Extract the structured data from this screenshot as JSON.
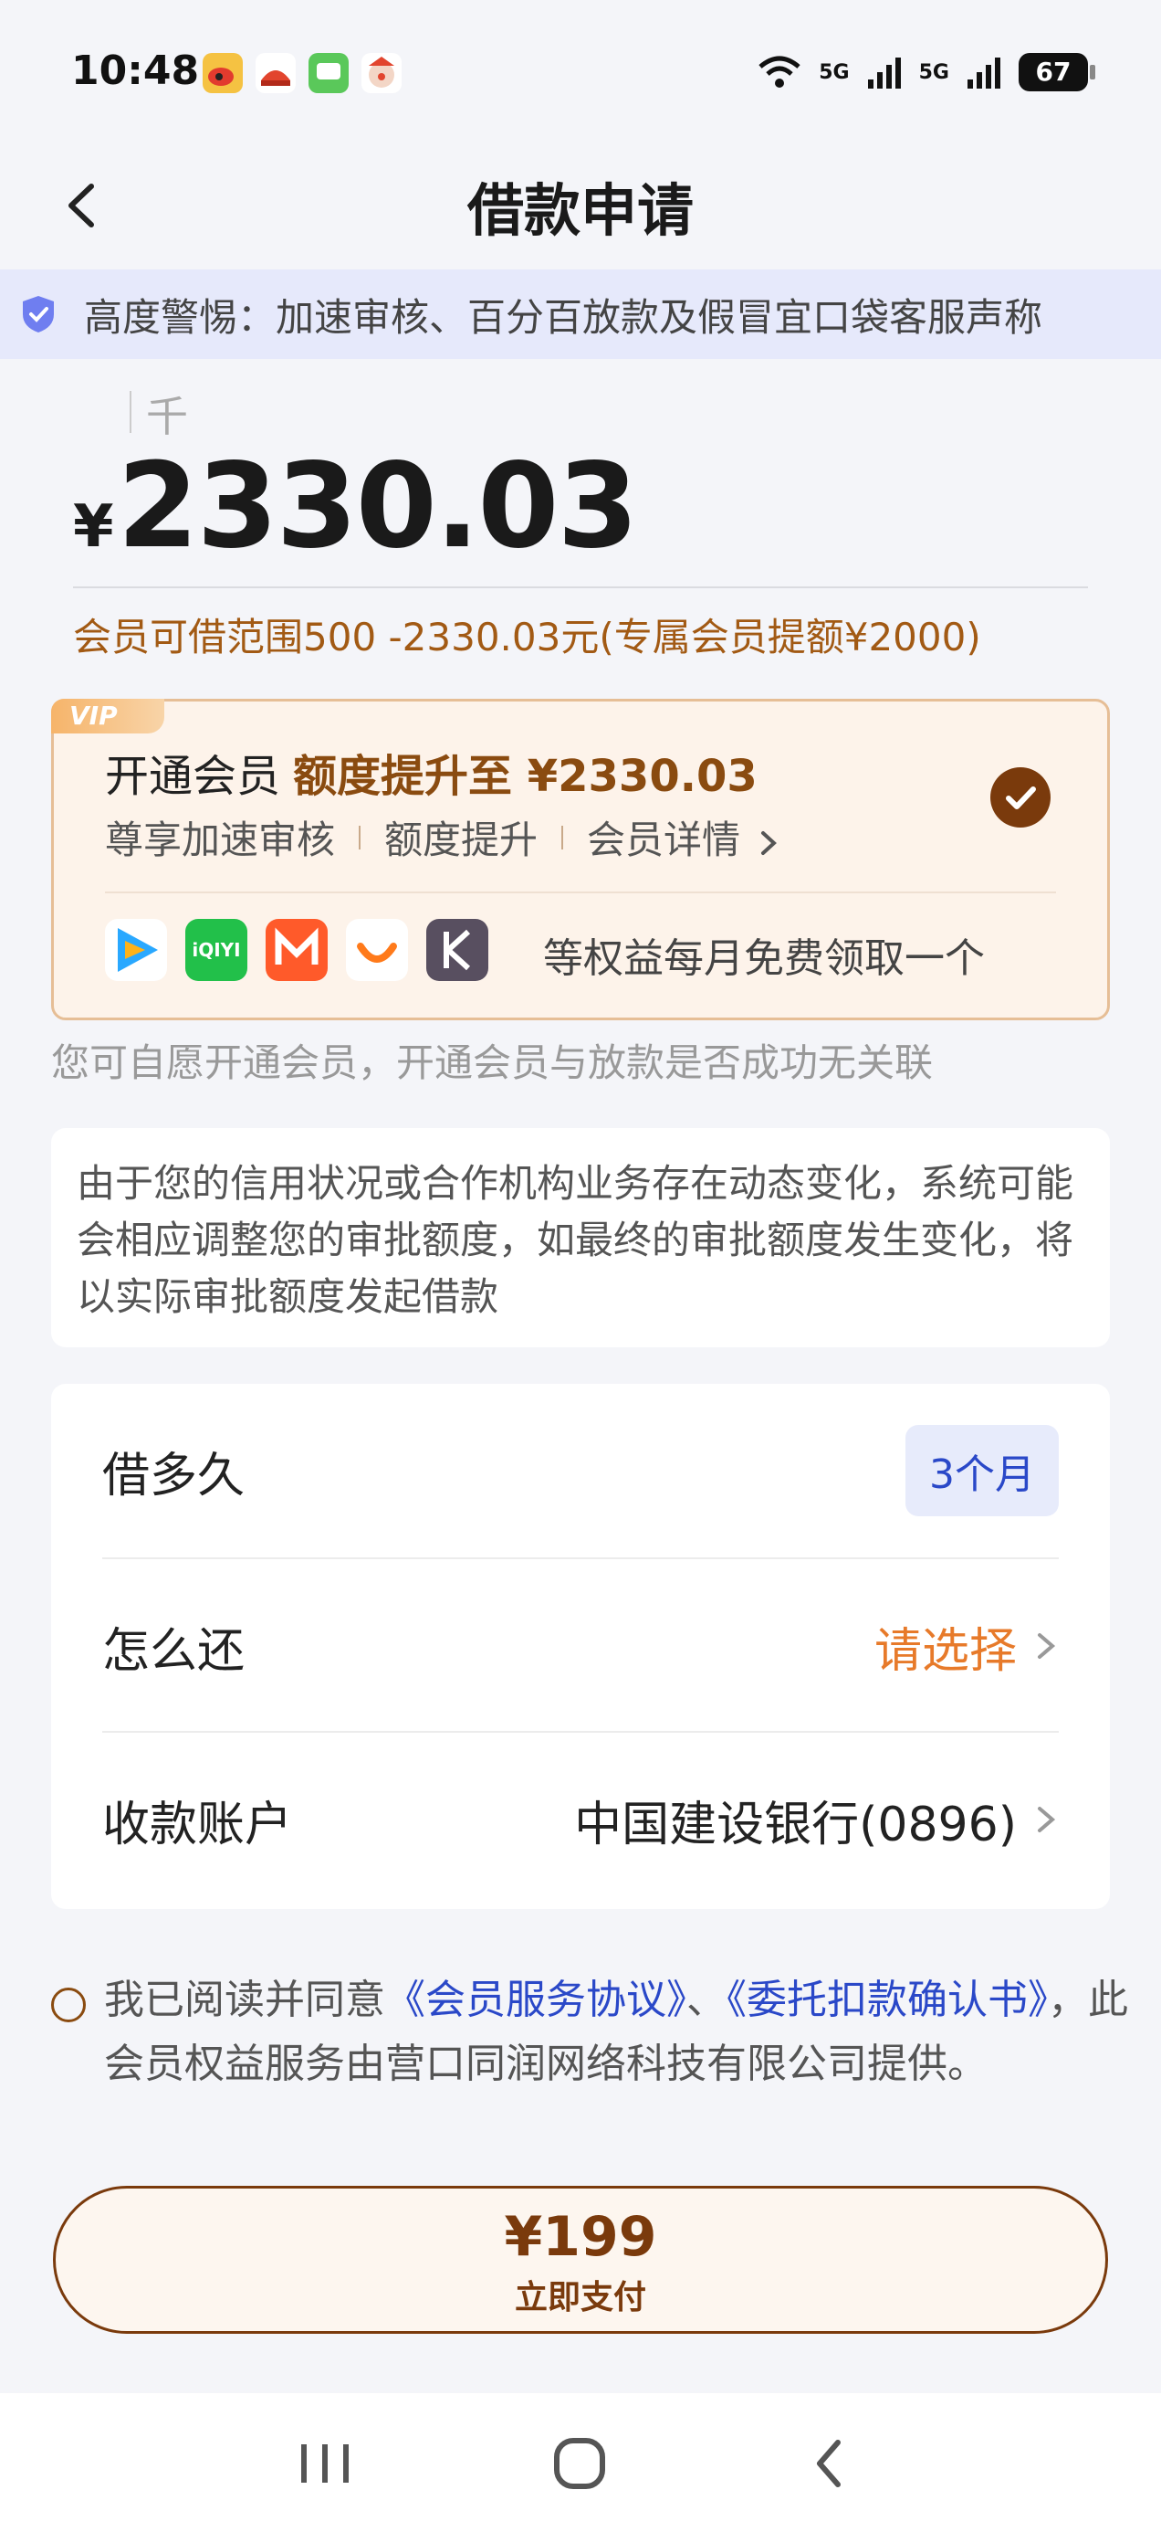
{
  "status_bar": {
    "time": "10:48",
    "battery": "67",
    "network_1": "5G",
    "network_2": "5G"
  },
  "header": {
    "title": "借款申请"
  },
  "warning_banner": {
    "text": "高度警惕：加速审核、百分百放款及假冒宜口袋客服声称"
  },
  "amount": {
    "unit_hint": "千",
    "currency_symbol": "¥",
    "value": "2330.03"
  },
  "range_text": "会员可借范围500 -2330.03元(专属会员提额¥2000)",
  "vip_card": {
    "tag": "VIP",
    "title_prefix": "开通会员",
    "title_highlight": "额度提升至 ¥2330.03",
    "feature_1": "尊享加速审核",
    "feature_2": "额度提升",
    "feature_3": "会员详情",
    "benefit_text": "等权益每月免费领取一个",
    "selected": true
  },
  "voluntary_text": "您可自愿开通会员，开通会员与放款是否成功无关联",
  "notice_text": "由于您的信用状况或合作机构业务存在动态变化，系统可能会相应调整您的审批额度，如最终的审批额度发生变化，将以实际审批额度发起借款",
  "options": {
    "term_label": "借多久",
    "term_value": "3个月",
    "repay_label": "怎么还",
    "repay_value": "请选择",
    "account_label": "收款账户",
    "account_value": "中国建设银行(0896)"
  },
  "agreement": {
    "prefix": "我已阅读并同意",
    "link_1": "《会员服务协议》",
    "separator": "、",
    "link_2": "《委托扣款确认书》",
    "suffix": "，此会员权益服务由营口同润网络科技有限公司提供。"
  },
  "pay_button": {
    "price": "¥199",
    "label": "立即支付"
  },
  "colors": {
    "accent_brown": "#7a3a0c",
    "accent_orange": "#e77a2a",
    "link_blue": "#2a48c8",
    "banner_bg": "#e6e9fb"
  },
  "icons": {
    "back": "chevron-left-icon",
    "shield": "shield-icon",
    "check": "check-circle-icon",
    "chevron": "chevron-right-icon"
  }
}
